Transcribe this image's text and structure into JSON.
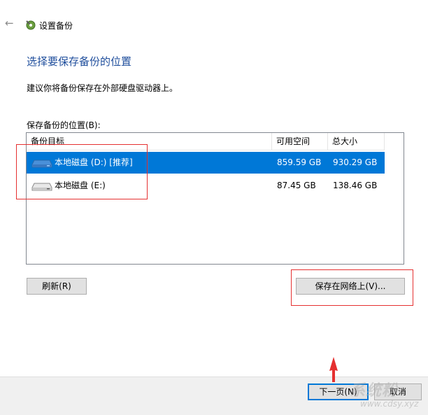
{
  "dialog": {
    "title": "设置备份",
    "heading": "选择要保存备份的位置",
    "subtext": "建议你将备份保存在外部硬盘驱动器上。",
    "list_label": "保存备份的位置(B):"
  },
  "table": {
    "columns": [
      "备份目标",
      "可用空间",
      "总大小"
    ],
    "rows": [
      {
        "name": "本地磁盘 (D:) [推荐]",
        "free": "859.59 GB",
        "total": "930.29 GB",
        "selected": true,
        "icon": "drive-icon"
      },
      {
        "name": "本地磁盘 (E:)",
        "free": "87.45 GB",
        "total": "138.46 GB",
        "selected": false,
        "icon": "drive-icon"
      }
    ]
  },
  "buttons": {
    "refresh": "刷新(R)",
    "save_network": "保存在网络上(V)...",
    "next": "下一页(N)",
    "cancel": "取消"
  },
  "watermark": {
    "text": "系统粉",
    "url": "www.cdsy.xyz"
  },
  "colors": {
    "accent": "#0078d7",
    "heading": "#1f4e9c",
    "annotation": "#e53030"
  }
}
